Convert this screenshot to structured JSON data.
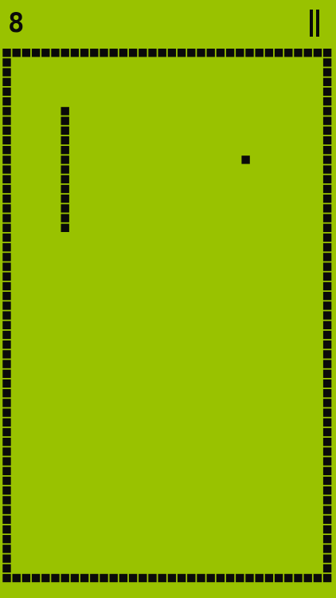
{
  "hud": {
    "score": "8",
    "pause_icon": "pause-icon"
  },
  "colors": {
    "playfield": "#99c200",
    "pixel": "#0a0a0a"
  },
  "game": {
    "snake_direction": "vertical",
    "snake_length": 13,
    "food_count": 1
  }
}
